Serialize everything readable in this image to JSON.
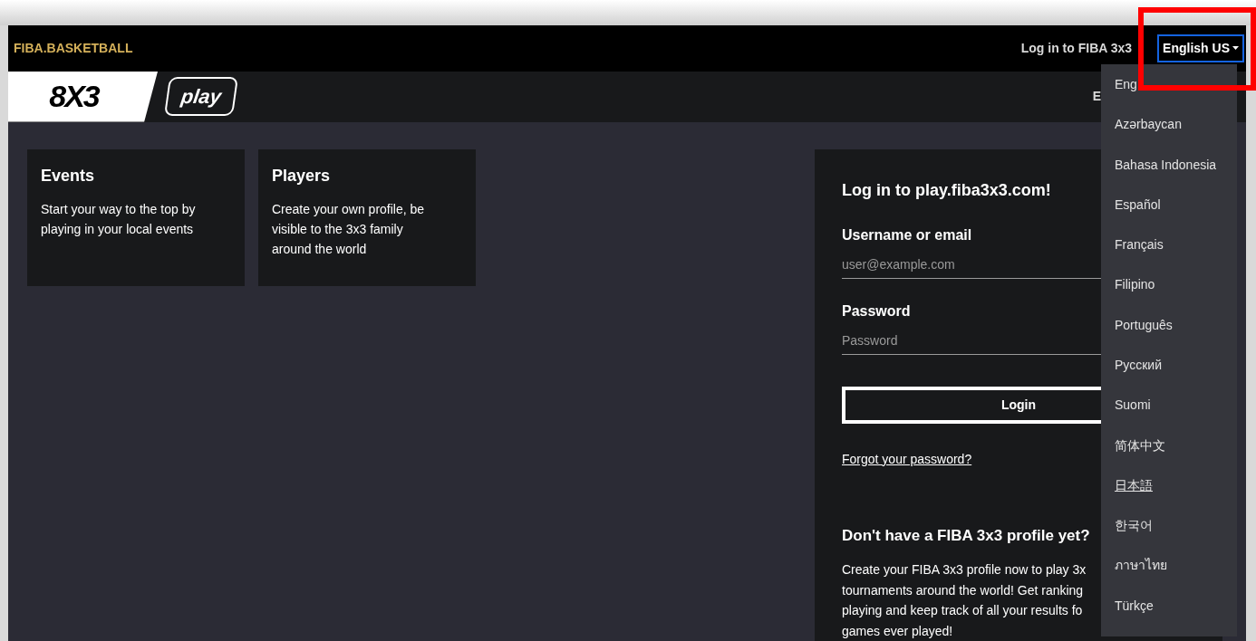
{
  "header": {
    "brand": "FIBA.BASKETBALL",
    "login_link": "Log in to FIBA 3x3",
    "language_button": "English US"
  },
  "logo_bar": {
    "logo": "8X3",
    "play_badge": "play",
    "nav_items": [
      "E"
    ]
  },
  "cards": [
    {
      "title": "Events",
      "text": "Start your way to the top by playing in your local events"
    },
    {
      "title": "Players",
      "text": "Create your own profile, be visible to the 3x3 family around the world"
    }
  ],
  "login": {
    "title": "Log in to play.fiba3x3.com!",
    "fields": [
      {
        "label": "Username or email",
        "placeholder": "user@example.com"
      },
      {
        "label": "Password",
        "placeholder": "Password"
      }
    ],
    "button": "Login",
    "forgot_link": "Forgot your password?",
    "signup_title": "Don't have a FIBA 3x3 profile yet?",
    "signup_lines": [
      "Create your FIBA 3x3 profile now to play 3x",
      "tournaments around the world! Get ranking",
      "playing and keep track of all your results fo",
      "games ever played!"
    ]
  },
  "language_menu": {
    "expanded": true,
    "items": [
      {
        "label": "Eng",
        "hovered": false
      },
      {
        "label": "Azərbaycan",
        "hovered": false
      },
      {
        "label": "Bahasa Indonesia",
        "hovered": false
      },
      {
        "label": "Español",
        "hovered": false
      },
      {
        "label": "Français",
        "hovered": false
      },
      {
        "label": "Filipino",
        "hovered": false
      },
      {
        "label": "Português",
        "hovered": false
      },
      {
        "label": "Русский",
        "hovered": false
      },
      {
        "label": "Suomi",
        "hovered": false
      },
      {
        "label": "简体中文",
        "hovered": false
      },
      {
        "label": "日本語",
        "hovered": true
      },
      {
        "label": "한국어",
        "hovered": false
      },
      {
        "label": "ภาษาไทย",
        "hovered": false
      },
      {
        "label": "Türkçe",
        "hovered": false
      }
    ]
  }
}
